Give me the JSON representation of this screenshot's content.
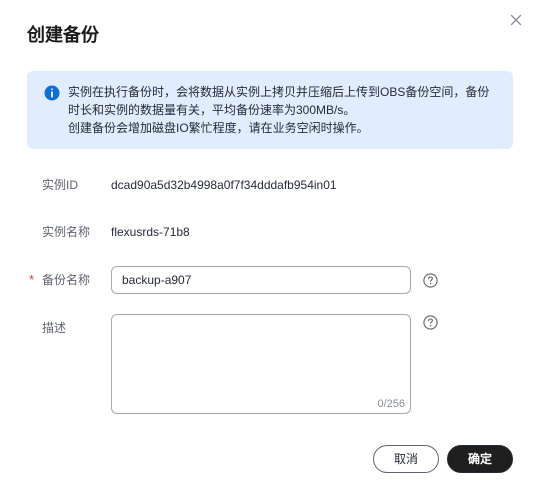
{
  "dialog": {
    "title": "创建备份",
    "close_icon": "close-icon"
  },
  "notice": {
    "icon": "info-icon",
    "line1": "实例在执行备份时，会将数据从实例上拷贝并压缩后上传到OBS备份空间，备份",
    "line2": "时长和实例的数据量有关，平均备份速率为300MB/s。",
    "line3": "创建备份会增加磁盘IO繁忙程度，请在业务空闲时操作。",
    "accent_color": "#0d6ddb",
    "background_color": "#e1edfc"
  },
  "form": {
    "instance_id": {
      "label": "实例ID",
      "value": "dcad90a5d32b4998a0f7f34dddafb954in01"
    },
    "instance_name": {
      "label": "实例名称",
      "value": "flexusrds-71b8"
    },
    "backup_name": {
      "required_mark": "*",
      "label": "备份名称",
      "value": "backup-a907",
      "help_icon": "help-circle-icon"
    },
    "description": {
      "label": "描述",
      "value": "",
      "counter": "0/256",
      "help_icon": "help-circle-icon"
    }
  },
  "footer": {
    "cancel_label": "取消",
    "confirm_label": "确定"
  }
}
